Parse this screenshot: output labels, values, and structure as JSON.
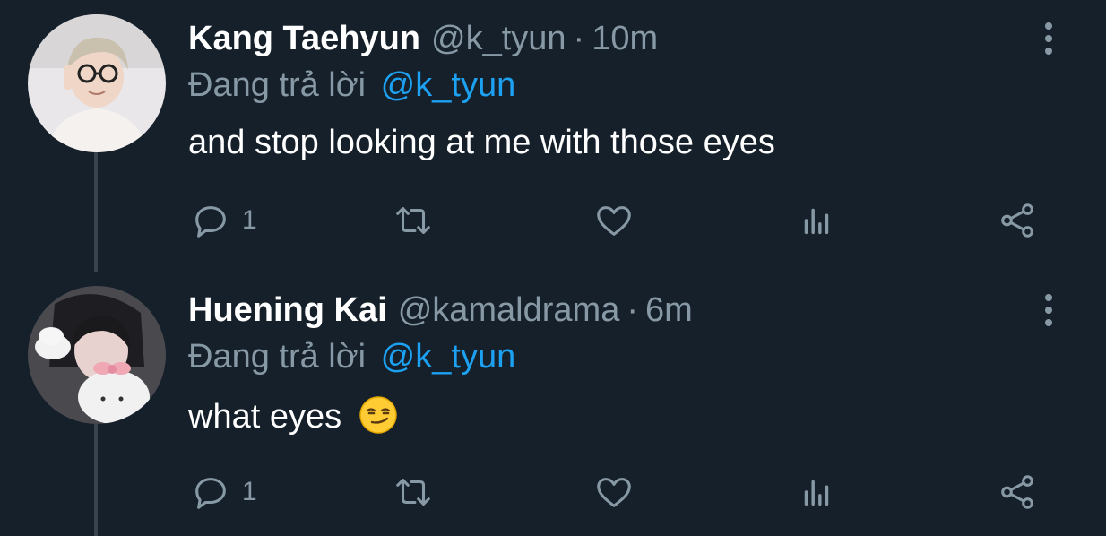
{
  "tweets": [
    {
      "display_name": "Kang Taehyun",
      "handle": "@k_tyun",
      "separator": "·",
      "time": "10m",
      "reply_prefix": "Đang trả lời",
      "reply_mention": "@k_tyun",
      "text": "and stop looking at me with those eyes",
      "emoji": "",
      "reply_count": "1",
      "avatar_icon": "avatar-photo"
    },
    {
      "display_name": "Huening Kai",
      "handle": "@kamaldrama",
      "separator": "·",
      "time": "6m",
      "reply_prefix": "Đang trả lời",
      "reply_mention": "@k_tyun",
      "text": "what eyes",
      "emoji": "smirking-face",
      "reply_count": "1",
      "avatar_icon": "avatar-photo"
    }
  ],
  "icons": {
    "reply": "comment-bubble-icon",
    "retweet": "retweet-icon",
    "like": "heart-icon",
    "stats": "analytics-icon",
    "share": "share-icon",
    "more": "more-vertical-icon"
  },
  "colors": {
    "background": "#15202b",
    "secondary_text": "#8899a6",
    "mention": "#1da1f2",
    "thread_line": "#38444d"
  }
}
